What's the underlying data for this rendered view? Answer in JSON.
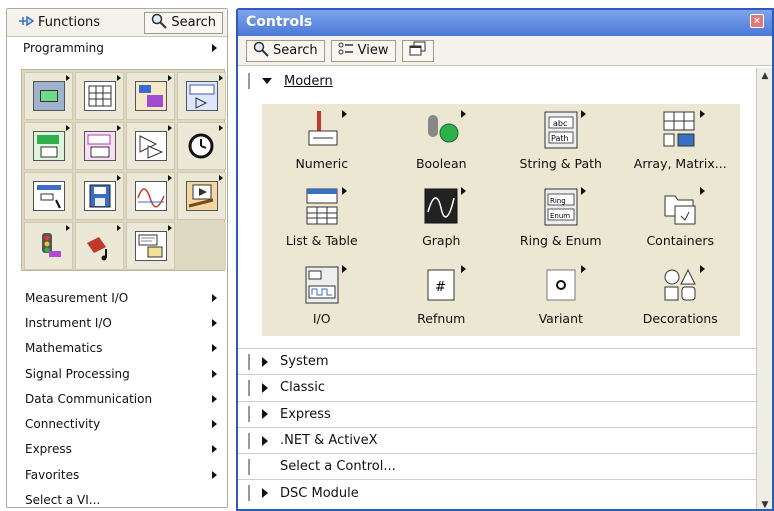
{
  "functions": {
    "tabs": {
      "functions_label": "Functions",
      "search_label": "Search"
    },
    "category": "Programming",
    "icons": [
      "structures-icon",
      "array-icon",
      "cluster-icon",
      "numeric-icon",
      "boolean-icon",
      "string-icon",
      "comparison-icon",
      "timing-icon",
      "dialog-icon",
      "file-io-icon",
      "waveform-icon",
      "application-control-icon",
      "synchronization-icon",
      "graphics-sound-icon",
      "report-generation-icon"
    ],
    "items": [
      {
        "label": "Measurement I/O",
        "has_submenu": true
      },
      {
        "label": "Instrument I/O",
        "has_submenu": true
      },
      {
        "label": "Mathematics",
        "has_submenu": true
      },
      {
        "label": "Signal Processing",
        "has_submenu": true
      },
      {
        "label": "Data Communication",
        "has_submenu": true
      },
      {
        "label": "Connectivity",
        "has_submenu": true
      },
      {
        "label": "Express",
        "has_submenu": true
      },
      {
        "label": "Favorites",
        "has_submenu": true
      },
      {
        "label": "Select a VI...",
        "has_submenu": false
      }
    ]
  },
  "controls": {
    "title": "Controls",
    "toolbar": {
      "search_label": "Search",
      "view_label": "View"
    },
    "modern": {
      "label": "Modern",
      "items": [
        {
          "label": "Numeric",
          "icon": "numeric-icon"
        },
        {
          "label": "Boolean",
          "icon": "boolean-icon"
        },
        {
          "label": "String & Path",
          "icon": "string-path-icon"
        },
        {
          "label": "Array, Matrix...",
          "icon": "array-matrix-icon"
        },
        {
          "label": "List & Table",
          "icon": "list-table-icon"
        },
        {
          "label": "Graph",
          "icon": "graph-icon"
        },
        {
          "label": "Ring & Enum",
          "icon": "ring-enum-icon"
        },
        {
          "label": "Containers",
          "icon": "containers-icon"
        },
        {
          "label": "I/O",
          "icon": "io-icon"
        },
        {
          "label": "Refnum",
          "icon": "refnum-icon"
        },
        {
          "label": "Variant",
          "icon": "variant-icon"
        },
        {
          "label": "Decorations",
          "icon": "decorations-icon"
        }
      ]
    },
    "categories": [
      {
        "label": "System",
        "has_arrow": true
      },
      {
        "label": "Classic",
        "has_arrow": true
      },
      {
        "label": "Express",
        "has_arrow": true
      },
      {
        "label": ".NET & ActiveX",
        "has_arrow": true
      },
      {
        "label": "Select a Control...",
        "has_arrow": false
      },
      {
        "label": "DSC Module",
        "has_arrow": true
      }
    ]
  },
  "colors": {
    "title_bar": "#4a78d6",
    "palette_bg": "#ece7d2"
  }
}
